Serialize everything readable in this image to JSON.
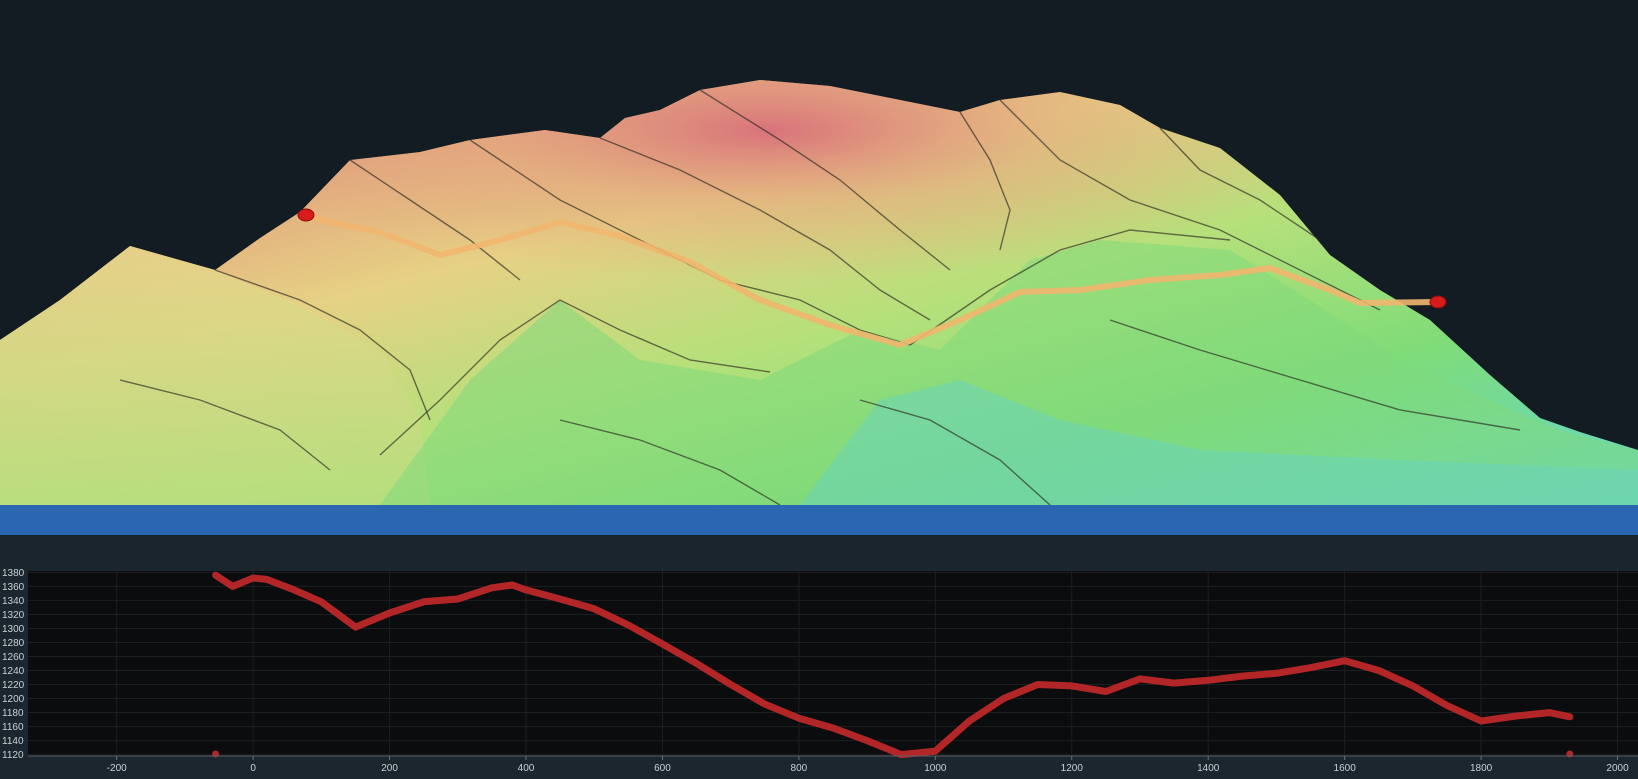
{
  "viewport": {
    "background": "#141c23",
    "elevation_colormap": [
      "#62d6cf",
      "#7fdc78",
      "#c9e27a",
      "#e9cd84",
      "#e58f7e",
      "#d86a7a"
    ],
    "profile_line_color": "#f1b66e",
    "endpoint_marker_color": "#d81b1b"
  },
  "splitter": {
    "color": "#2b67b0"
  },
  "chart_data": {
    "type": "line",
    "title": "",
    "xlabel": "",
    "ylabel": "",
    "xlim": [
      -330,
      2030
    ],
    "ylim": [
      1118,
      1382
    ],
    "x_ticks": [
      -200,
      0,
      200,
      400,
      600,
      800,
      1000,
      1200,
      1400,
      1600,
      1800,
      2000
    ],
    "y_ticks": [
      1120,
      1140,
      1160,
      1180,
      1200,
      1220,
      1240,
      1260,
      1280,
      1300,
      1320,
      1340,
      1360,
      1380
    ],
    "grid": true,
    "line_color": "#b32627",
    "background": "#0b0c0d",
    "series": [
      {
        "x": [
          -55,
          -30,
          -10,
          0,
          20,
          60,
          100,
          150,
          200,
          250,
          300,
          350,
          380,
          400,
          450,
          500,
          550,
          600,
          650,
          700,
          750,
          800,
          850,
          900,
          950,
          1000,
          1050,
          1100,
          1150,
          1200,
          1250,
          1300,
          1350,
          1400,
          1450,
          1500,
          1550,
          1600,
          1650,
          1700,
          1750,
          1800,
          1850,
          1900,
          1930
        ],
        "y": [
          1376,
          1360,
          1368,
          1372,
          1370,
          1355,
          1338,
          1302,
          1322,
          1338,
          1342,
          1358,
          1362,
          1355,
          1342,
          1328,
          1305,
          1278,
          1250,
          1220,
          1192,
          1172,
          1158,
          1140,
          1120,
          1125,
          1168,
          1200,
          1220,
          1218,
          1210,
          1228,
          1222,
          1226,
          1232,
          1236,
          1244,
          1254,
          1240,
          1218,
          1190,
          1168,
          1175,
          1180,
          1174
        ]
      }
    ],
    "endpoint_markers_x": [
      -55,
      1930
    ]
  }
}
